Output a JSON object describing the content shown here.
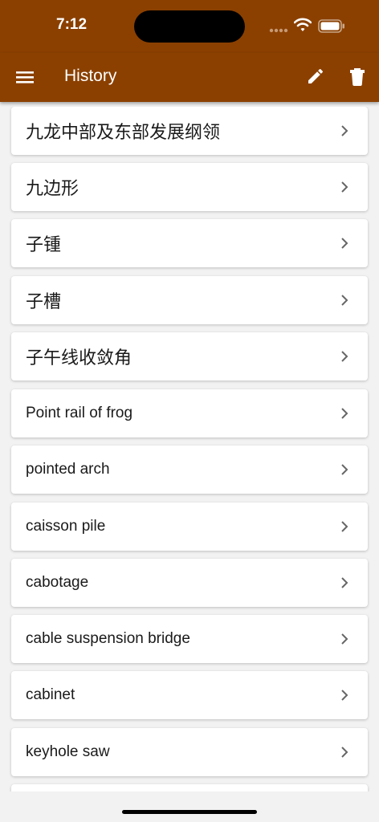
{
  "status_bar": {
    "time": "7:12"
  },
  "app_bar": {
    "title": "History",
    "menu_icon": "menu-icon",
    "edit_icon": "pencil-icon",
    "delete_icon": "trash-icon"
  },
  "history": {
    "items": [
      {
        "label": "九龙中部及东部发展纲领"
      },
      {
        "label": "九边形"
      },
      {
        "label": "子锺"
      },
      {
        "label": "子槽"
      },
      {
        "label": "子午线收敛角"
      },
      {
        "label": "Point rail of frog"
      },
      {
        "label": "pointed arch"
      },
      {
        "label": "caisson pile"
      },
      {
        "label": "cabotage"
      },
      {
        "label": "cable suspension bridge"
      },
      {
        "label": "cabinet"
      },
      {
        "label": "keyhole saw"
      }
    ]
  },
  "colors": {
    "app_bar": "#8b4000",
    "background": "#f2f2f2",
    "card": "#ffffff"
  }
}
